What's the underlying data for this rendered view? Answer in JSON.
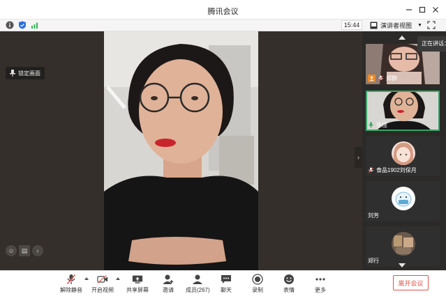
{
  "window": {
    "title": "腾讯会议"
  },
  "statusbar": {
    "time": "15:44",
    "view_label": "演讲者视图"
  },
  "stage": {
    "lock_label": "锁定画面"
  },
  "speaking_tip": "正在讲话：",
  "participants": [
    {
      "name": "郑群",
      "role": "host"
    },
    {
      "name": "张佳",
      "role": "speaking"
    },
    {
      "name": "食品1902刘保月",
      "role": "member"
    },
    {
      "name": "刘芳",
      "role": "member"
    },
    {
      "name": "郑行",
      "role": "member"
    }
  ],
  "toolbar": {
    "unmute": "解除静音",
    "start_video": "开启视频",
    "share_screen": "共享屏幕",
    "invite": "邀请",
    "members": "成员(267)",
    "chat": "聊天",
    "record": "录制",
    "reactions": "表情",
    "more": "更多",
    "leave": "离开会议"
  },
  "colors": {
    "accent_green": "#3aa567",
    "leave_red": "#e0534a",
    "host_orange": "#f08a24"
  }
}
